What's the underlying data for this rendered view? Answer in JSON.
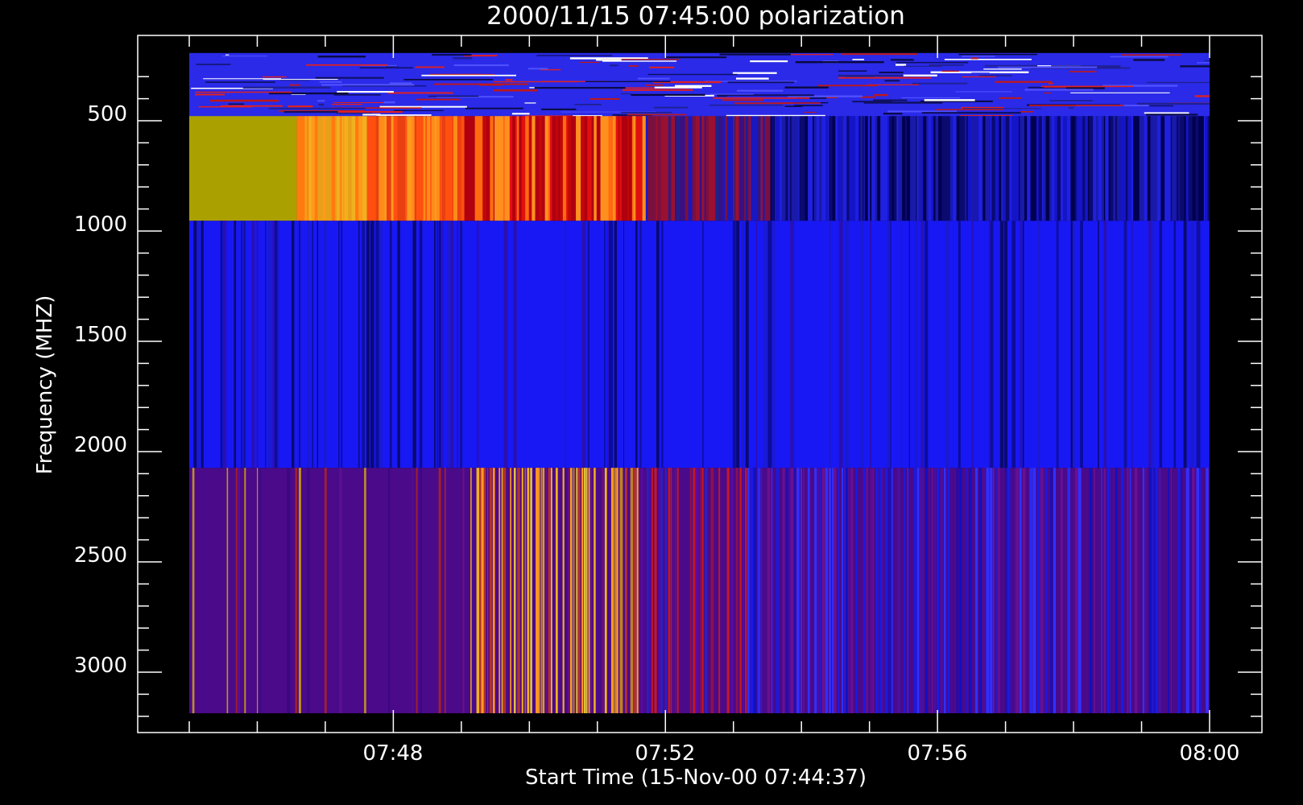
{
  "chart_data": {
    "type": "heatmap",
    "title": "2000/11/15 07:45:00 polarization",
    "xlabel": "Start Time (15-Nov-00 07:44:37)",
    "ylabel": "Frequency (MHZ)",
    "x_range": [
      "07:45:00",
      "08:00:00"
    ],
    "y_range_mhz": [
      200,
      3200
    ],
    "y_axis_inverted": true,
    "x_ticks": [
      "07:48",
      "07:52",
      "07:56",
      "08:00"
    ],
    "y_ticks": [
      "500",
      "1000",
      "1500",
      "2000",
      "2500",
      "3000"
    ],
    "y_tick_values": [
      500,
      1000,
      1500,
      2000,
      2500,
      3000
    ],
    "grid": false,
    "bands": [
      {
        "freq_range_mhz": [
          200,
          530
        ],
        "pattern": "noisy blue with scattered red and white horizontal streaks",
        "base_color": "#2a2ae8"
      },
      {
        "freq_range_mhz": [
          530,
          990
        ],
        "pattern": "olive until about 07:46:35, then orange/red vertical striping through about 07:51:40, fading to dark blue stripes afterwards",
        "colors": [
          "#aaa000",
          "#ff8c1a",
          "#e01010",
          "#8a1040",
          "#1414c8",
          "#000050"
        ]
      },
      {
        "freq_range_mhz": [
          990,
          2110
        ],
        "pattern": "mostly blue with dark blue vertical stripes, denser near the start",
        "base_color": "#1818f5"
      },
      {
        "freq_range_mhz": [
          2110,
          3230
        ],
        "pattern": "purple with yellow and orange vertical stripes between about 07:49 and 07:51:30, transitioning to blue and purple stripes later",
        "base_color": "#4a0a8a"
      }
    ]
  }
}
